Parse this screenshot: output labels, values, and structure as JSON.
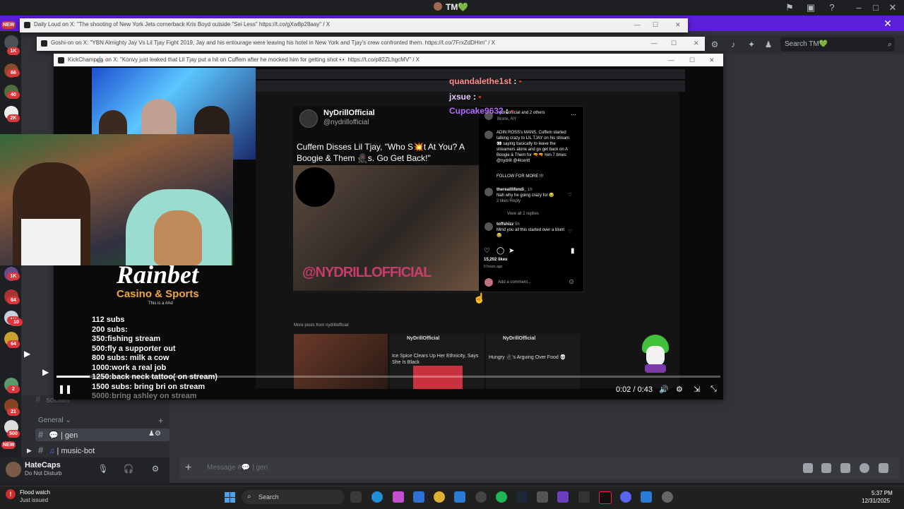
{
  "discord": {
    "app_title": "TM💚",
    "search_placeholder": "Search TM💚",
    "server_badges": [
      "NEW",
      "1K",
      "66",
      "40",
      "2K",
      "1K",
      "64",
      "1K",
      "10",
      "64",
      "2",
      "21",
      "500",
      "NEW"
    ],
    "channels": {
      "category": "General",
      "items": [
        {
          "icon": "speech-bubble-icon",
          "label": "| gen"
        },
        {
          "icon": "music-note-icon",
          "label": "| music-bot"
        }
      ],
      "faded_label": "socials"
    },
    "user": {
      "name": "HateCaps",
      "status": "Do Not Disturb"
    },
    "message_placeholder": "Message #💬 | gen"
  },
  "windows": [
    {
      "title": "Daily Loud on X: \"The shooting of New York Jets cornerback Kris Boyd outside \"Sei Less\" https://t.co/gXw8p28aay\" / X"
    },
    {
      "title": "Goshi-on on X: \"YBN Almighty Jay Vs Lil Tjay Fight 2019, Jay and his entourage were leaving his hotel in New York and Tjay's crew confronted them. https://t.co/7FrxZdDHim\" / X"
    },
    {
      "title": "KickChamp🤖 on X: \"Konvy just leaked that Lil Tjay put a hit on Cuffem after he mocked him for getting shot 👀 https://t.co/p82ZLhgcMV\" / X"
    }
  ],
  "chat": [
    {
      "user": "quandalethe1st",
      "color": "#ff8a8a"
    },
    {
      "user": "jxsue",
      "color": "#e6c6ff"
    },
    {
      "user": "Cupcake9632",
      "color": "#b36bff"
    }
  ],
  "instagram": {
    "author": "NyDrillOfficial",
    "handle": "@nydrillofficial",
    "caption": "Cuffem Disses Lil Tjay, \"Who S💥t At You? A Boogie & Them 🥷🏿s. Go Get Back!\"",
    "watermark": "@NYDRILLOFFICIAL",
    "header_right": "nydrillofficial and 2 others",
    "location": "Bronx, NY",
    "post_text": "ADIN ROSS's MANS, Cuffem started talking crazy to LIL TJAY on his stream 👀 saying basically to leave the streamers alone and go get back on A Boogie & Them for 🔫🔫 him 7 times @nydrill @4lcentt",
    "follow": "FOLLOW FOR MORE !!!",
    "comments": [
      {
        "user": "therealllifendi_",
        "time": "1h",
        "text": "Nah why he going crazy for 😂",
        "meta": "2 likes   Reply"
      },
      {
        "user": "toffshizz",
        "time": "5h",
        "text": "Mind you all this started over a blunt 😂",
        "meta": ""
      }
    ],
    "view_replies": "View all 2 replies",
    "likes": "15,202 likes",
    "ago": "5 hours ago",
    "add_comment": "Add a comment...",
    "more_posts": "More posts from nydrillofficial",
    "more_tiles": [
      {
        "author": "",
        "title": ""
      },
      {
        "author": "NyDrillOfficial",
        "title": "Ice Spice Clears Up Her Ethnicity, Says She Is Black"
      },
      {
        "author": "NyDrillOfficial",
        "title": "Hungry 🥷🏿's Arguing Over Food 💀"
      }
    ]
  },
  "sponsor": {
    "brand": "Rainbet",
    "tagline": "Casino & Sports",
    "disclaimer": "This is a #Ad"
  },
  "goals": [
    "112 subs",
    "200 subs:",
    "350:fishing stream",
    "500:fly a supporter out",
    "800 subs:  milk a cow",
    "1000:work a real job",
    "1250:back neck tattoo( on stream)",
    "1500 subs: bring bri on stream",
    "5000:bring ashley on stream"
  ],
  "player": {
    "timecode": "0:02 / 0:43",
    "progress": 0.05
  },
  "taskbar": {
    "notification_title": "Flood watch",
    "notification_sub": "Just issued",
    "search_label": "Search",
    "time": "5:37 PM",
    "date": "12/31/2025"
  },
  "colors": {
    "banner": "#5c1fd9",
    "accent": "#5865f2",
    "badge": "#da373c"
  }
}
